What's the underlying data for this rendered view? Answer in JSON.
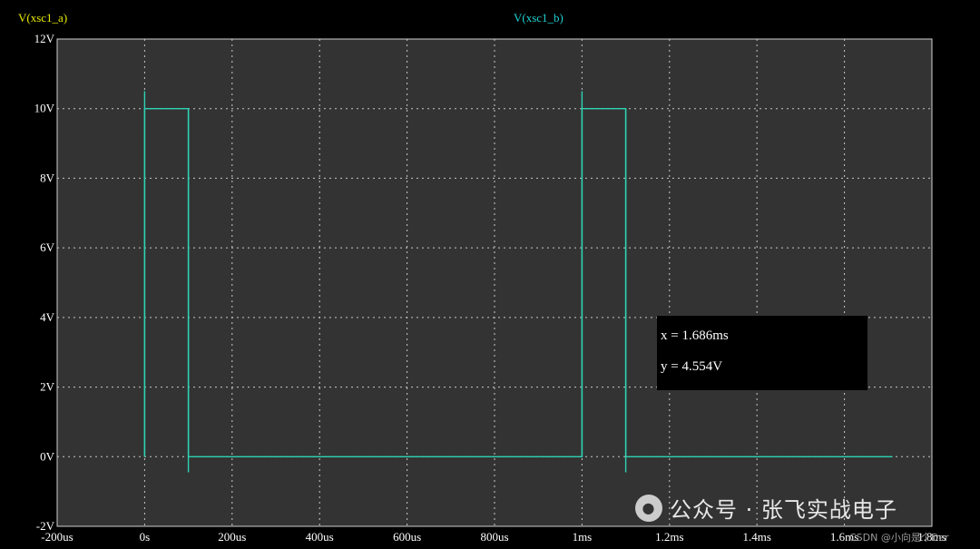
{
  "legend": {
    "series_a": "V(xsc1_a)",
    "series_b": "V(xsc1_b)",
    "series_a_color": "#e8e800",
    "series_b_color": "#20d0d0"
  },
  "cursor_readout": {
    "x": "x = 1.686ms",
    "y": "y = 4.554V"
  },
  "watermark": {
    "logo_icon": "wechat-icon",
    "text": "公众号 · 张飞实战电子"
  },
  "credit": "CSDN @小向是个Der",
  "colors": {
    "background": "#000000",
    "plot_background": "#333333",
    "grid": "#c8c8c8",
    "trace": "#2ed3b4"
  },
  "chart_data": {
    "type": "line",
    "title": "",
    "xlabel": "",
    "ylabel": "",
    "xlim": [
      -0.2,
      1.8
    ],
    "ylim": [
      -2,
      12
    ],
    "grid": true,
    "x_ticks": [
      {
        "value": -0.2,
        "label": "-200us"
      },
      {
        "value": 0,
        "label": "0s"
      },
      {
        "value": 0.2,
        "label": "200us"
      },
      {
        "value": 0.4,
        "label": "400us"
      },
      {
        "value": 0.6,
        "label": "600us"
      },
      {
        "value": 0.8,
        "label": "800us"
      },
      {
        "value": 1.0,
        "label": "1ms"
      },
      {
        "value": 1.2,
        "label": "1.2ms"
      },
      {
        "value": 1.4,
        "label": "1.4ms"
      },
      {
        "value": 1.6,
        "label": "1.6ms"
      },
      {
        "value": 1.8,
        "label": "1.8ms"
      }
    ],
    "y_ticks": [
      {
        "value": -2,
        "label": "-2V"
      },
      {
        "value": 0,
        "label": "0V"
      },
      {
        "value": 2,
        "label": "2V"
      },
      {
        "value": 4,
        "label": "4V"
      },
      {
        "value": 6,
        "label": "6V"
      },
      {
        "value": 8,
        "label": "8V"
      },
      {
        "value": 10,
        "label": "10V"
      },
      {
        "value": 12,
        "label": "12V"
      }
    ],
    "series": [
      {
        "name": "V(xsc1_b)",
        "color": "#2ed3b4",
        "x": [
          0,
          0,
          0.1,
          0.1,
          1.0,
          1.0,
          1.1,
          1.1,
          1.71
        ],
        "y": [
          0,
          10,
          10,
          0,
          0,
          10,
          10,
          0,
          0
        ]
      }
    ],
    "spikes": [
      {
        "x": 0,
        "y_from": 0,
        "y_to": 10.5
      },
      {
        "x": 0.1,
        "y_from": 10,
        "y_to": -0.45
      },
      {
        "x": 1.0,
        "y_from": 0,
        "y_to": 10.5
      },
      {
        "x": 1.1,
        "y_from": 10,
        "y_to": -0.45
      }
    ]
  }
}
